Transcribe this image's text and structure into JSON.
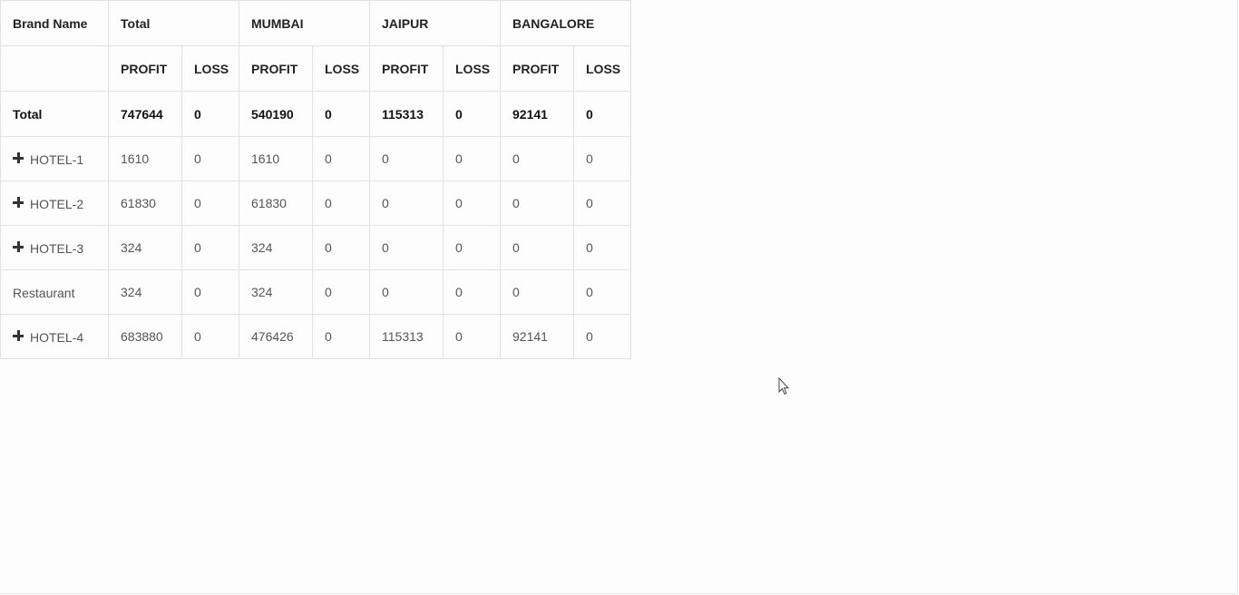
{
  "table": {
    "headers": {
      "brand": "Brand Name",
      "total": "Total",
      "cities": [
        "MUMBAI",
        "JAIPUR",
        "BANGALORE"
      ]
    },
    "subheaders": {
      "profit": "PROFIT",
      "loss": "LOSS"
    },
    "total_row": {
      "label": "Total",
      "values": [
        "747644",
        "0",
        "540190",
        "0",
        "115313",
        "0",
        "92141",
        "0"
      ]
    },
    "rows": [
      {
        "label": "HOTEL-1",
        "expandable": true,
        "values": [
          "1610",
          "0",
          "1610",
          "0",
          "0",
          "0",
          "0",
          "0"
        ]
      },
      {
        "label": "HOTEL-2",
        "expandable": true,
        "values": [
          "61830",
          "0",
          "61830",
          "0",
          "0",
          "0",
          "0",
          "0"
        ]
      },
      {
        "label": "HOTEL-3",
        "expandable": true,
        "values": [
          "324",
          "0",
          "324",
          "0",
          "0",
          "0",
          "0",
          "0"
        ]
      },
      {
        "label": "Restaurant",
        "expandable": false,
        "values": [
          "324",
          "0",
          "324",
          "0",
          "0",
          "0",
          "0",
          "0"
        ]
      },
      {
        "label": "HOTEL-4",
        "expandable": true,
        "values": [
          "683880",
          "0",
          "476426",
          "0",
          "115313",
          "0",
          "92141",
          "0"
        ]
      }
    ]
  },
  "icons": {
    "expand": "plus-icon",
    "cursor": "mouse-pointer-icon"
  },
  "colors": {
    "border": "#dfe0e8",
    "text": "#333333",
    "background": "#fdfdfe"
  }
}
